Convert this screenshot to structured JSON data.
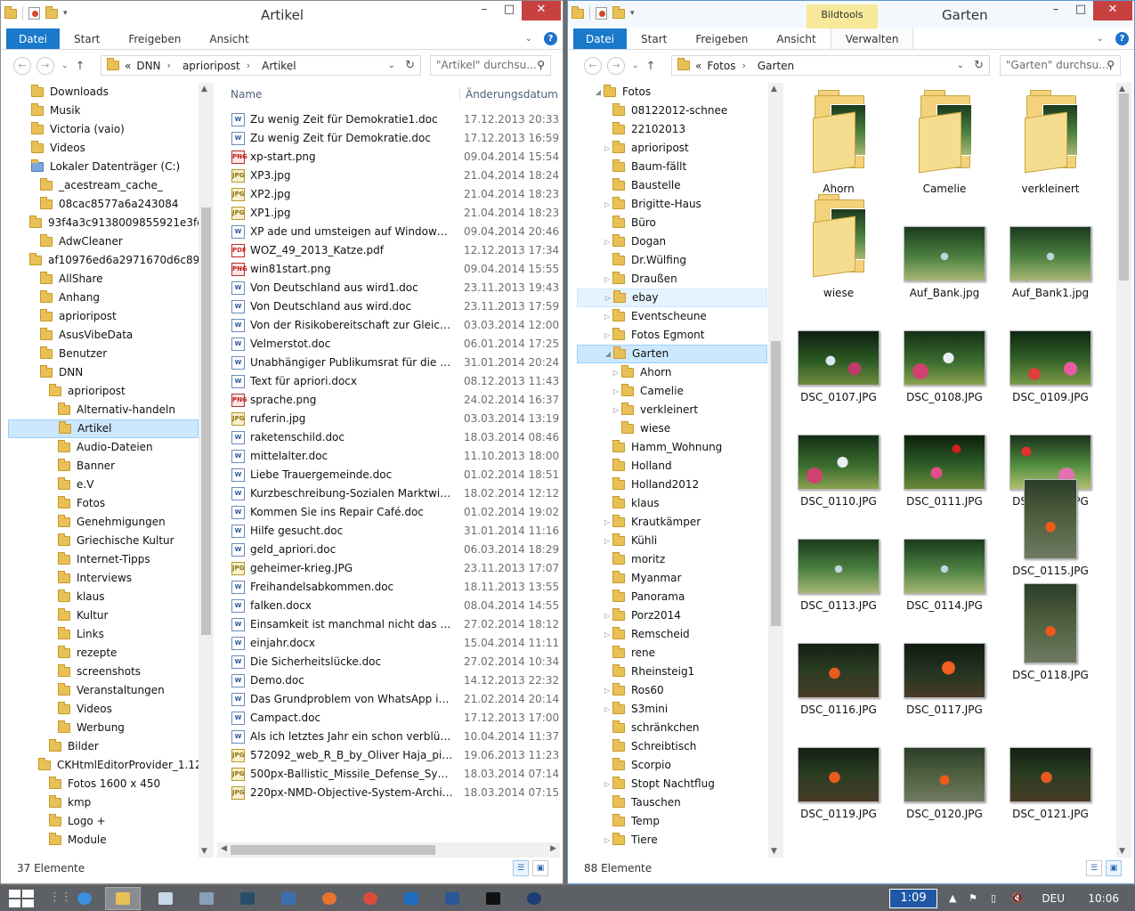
{
  "left": {
    "title": "Artikel",
    "tabs": [
      "Datei",
      "Start",
      "Freigeben",
      "Ansicht"
    ],
    "breadcrumb": [
      "«",
      "DNN",
      "aprioripost",
      "Artikel"
    ],
    "search_placeholder": "\"Artikel\" durchsu...",
    "status": "37 Elemente",
    "col_name": "Name",
    "col_date": "Änderungsdatum",
    "tree": [
      {
        "label": "Downloads",
        "indent": 0,
        "ex": ""
      },
      {
        "label": "Musik",
        "indent": 0,
        "ex": ""
      },
      {
        "label": "Victoria (vaio)",
        "indent": 0,
        "ex": ""
      },
      {
        "label": "Videos",
        "indent": 0,
        "ex": ""
      },
      {
        "label": "Lokaler Datenträger (C:)",
        "indent": 0,
        "ex": "",
        "drive": true
      },
      {
        "label": "_acestream_cache_",
        "indent": 1,
        "ex": ""
      },
      {
        "label": "08cac8577a6a243084",
        "indent": 1,
        "ex": ""
      },
      {
        "label": "93f4a3c9138009855921e3fe",
        "indent": 1,
        "ex": ""
      },
      {
        "label": "AdwCleaner",
        "indent": 1,
        "ex": ""
      },
      {
        "label": "af10976ed6a2971670d6c89be2",
        "indent": 1,
        "ex": ""
      },
      {
        "label": "AllShare",
        "indent": 1,
        "ex": ""
      },
      {
        "label": "Anhang",
        "indent": 1,
        "ex": ""
      },
      {
        "label": "aprioripost",
        "indent": 1,
        "ex": ""
      },
      {
        "label": "AsusVibeData",
        "indent": 1,
        "ex": ""
      },
      {
        "label": "Benutzer",
        "indent": 1,
        "ex": ""
      },
      {
        "label": "DNN",
        "indent": 1,
        "ex": ""
      },
      {
        "label": "aprioripost",
        "indent": 2,
        "ex": ""
      },
      {
        "label": "Alternativ-handeln",
        "indent": 3,
        "ex": ""
      },
      {
        "label": "Artikel",
        "indent": 3,
        "ex": "",
        "sel": true
      },
      {
        "label": "Audio-Dateien",
        "indent": 3,
        "ex": ""
      },
      {
        "label": "Banner",
        "indent": 3,
        "ex": ""
      },
      {
        "label": "e.V",
        "indent": 3,
        "ex": ""
      },
      {
        "label": "Fotos",
        "indent": 3,
        "ex": ""
      },
      {
        "label": "Genehmigungen",
        "indent": 3,
        "ex": ""
      },
      {
        "label": "Griechische Kultur",
        "indent": 3,
        "ex": ""
      },
      {
        "label": "Internet-Tipps",
        "indent": 3,
        "ex": ""
      },
      {
        "label": "Interviews",
        "indent": 3,
        "ex": ""
      },
      {
        "label": "klaus",
        "indent": 3,
        "ex": ""
      },
      {
        "label": "Kultur",
        "indent": 3,
        "ex": ""
      },
      {
        "label": "Links",
        "indent": 3,
        "ex": ""
      },
      {
        "label": "rezepte",
        "indent": 3,
        "ex": ""
      },
      {
        "label": "screenshots",
        "indent": 3,
        "ex": ""
      },
      {
        "label": "Veranstaltungen",
        "indent": 3,
        "ex": ""
      },
      {
        "label": "Videos",
        "indent": 3,
        "ex": ""
      },
      {
        "label": "Werbung",
        "indent": 3,
        "ex": ""
      },
      {
        "label": "Bilder",
        "indent": 2,
        "ex": ""
      },
      {
        "label": "CKHtmlEditorProvider_1.12.",
        "indent": 2,
        "ex": ""
      },
      {
        "label": "Fotos 1600 x 450",
        "indent": 2,
        "ex": ""
      },
      {
        "label": "kmp",
        "indent": 2,
        "ex": ""
      },
      {
        "label": "Logo +",
        "indent": 2,
        "ex": ""
      },
      {
        "label": "Module",
        "indent": 2,
        "ex": ""
      }
    ],
    "files": [
      {
        "name": "Zu wenig Zeit für Demokratie1.doc",
        "date": "17.12.2013 20:33",
        "type": "doc"
      },
      {
        "name": "Zu wenig Zeit für Demokratie.doc",
        "date": "17.12.2013 16:59",
        "type": "doc"
      },
      {
        "name": "xp-start.png",
        "date": "09.04.2014 15:54",
        "type": "png"
      },
      {
        "name": "XP3.jpg",
        "date": "21.04.2014 18:24",
        "type": "jpg"
      },
      {
        "name": "XP2.jpg",
        "date": "21.04.2014 18:23",
        "type": "jpg"
      },
      {
        "name": "XP1.jpg",
        "date": "21.04.2014 18:23",
        "type": "jpg"
      },
      {
        "name": "XP ade und umsteigen auf Windows 8.do...",
        "date": "09.04.2014 20:46",
        "type": "doc"
      },
      {
        "name": "WOZ_49_2013_Katze.pdf",
        "date": "12.12.2013 17:34",
        "type": "pdf"
      },
      {
        "name": "win81start.png",
        "date": "09.04.2014 15:55",
        "type": "png"
      },
      {
        "name": "Von Deutschland aus wird1.doc",
        "date": "23.11.2013 19:43",
        "type": "doc"
      },
      {
        "name": "Von Deutschland aus wird.doc",
        "date": "23.11.2013 17:59",
        "type": "doc"
      },
      {
        "name": "Von der Risikobereitschaft zur Gleichgülti...",
        "date": "03.03.2014 12:00",
        "type": "doc"
      },
      {
        "name": "Velmerstot.doc",
        "date": "06.01.2014 17:25",
        "type": "doc"
      },
      {
        "name": "Unabhängiger Publikumsrat für die öffen...",
        "date": "31.01.2014 20:24",
        "type": "doc"
      },
      {
        "name": "Text für apriori.docx",
        "date": "08.12.2013 11:43",
        "type": "doc"
      },
      {
        "name": "sprache.png",
        "date": "24.02.2014 16:37",
        "type": "png"
      },
      {
        "name": "ruferin.jpg",
        "date": "03.03.2014 13:19",
        "type": "jpg"
      },
      {
        "name": "raketenschild.doc",
        "date": "18.03.2014 08:46",
        "type": "doc"
      },
      {
        "name": "mittelalter.doc",
        "date": "11.10.2013 18:00",
        "type": "doc"
      },
      {
        "name": "Liebe Trauergemeinde.doc",
        "date": "01.02.2014 18:51",
        "type": "doc"
      },
      {
        "name": "Kurzbeschreibung-Sozialen Marktwirtsch...",
        "date": "18.02.2014 12:12",
        "type": "doc"
      },
      {
        "name": "Kommen Sie ins Repair Café.doc",
        "date": "01.02.2014 19:02",
        "type": "doc"
      },
      {
        "name": "Hilfe gesucht.doc",
        "date": "31.01.2014 11:16",
        "type": "doc"
      },
      {
        "name": "geld_apriori.doc",
        "date": "06.03.2014 18:29",
        "type": "doc"
      },
      {
        "name": "geheimer-krieg.JPG",
        "date": "23.11.2013 17:07",
        "type": "jpg"
      },
      {
        "name": "Freihandelsabkommen.doc",
        "date": "18.11.2013 13:55",
        "type": "doc"
      },
      {
        "name": "falken.docx",
        "date": "08.04.2014 14:55",
        "type": "doc"
      },
      {
        "name": "Einsamkeit ist manchmal nicht das schle...",
        "date": "27.02.2014 18:12",
        "type": "doc"
      },
      {
        "name": "einjahr.docx",
        "date": "15.04.2014 11:11",
        "type": "doc"
      },
      {
        "name": "Die Sicherheitslücke.doc",
        "date": "27.02.2014 10:34",
        "type": "doc"
      },
      {
        "name": "Demo.doc",
        "date": "14.12.2013 22:32",
        "type": "doc"
      },
      {
        "name": "Das Grundproblem von WhatsApp ist.doc",
        "date": "21.02.2014 20:14",
        "type": "doc"
      },
      {
        "name": "Campact.doc",
        "date": "17.12.2013 17:00",
        "type": "doc"
      },
      {
        "name": "Als ich letztes Jahr ein schon verblühte K...",
        "date": "10.04.2014 11:37",
        "type": "doc"
      },
      {
        "name": "572092_web_R_B_by_Oliver Haja_pixelio.d...",
        "date": "19.06.2013 11:23",
        "type": "jpg"
      },
      {
        "name": "500px-Ballistic_Missile_Defense_System_(...",
        "date": "18.03.2014 07:14",
        "type": "jpg"
      },
      {
        "name": "220px-NMD-Objective-System-Architect...",
        "date": "18.03.2014 07:15",
        "type": "jpg"
      }
    ]
  },
  "right": {
    "title": "Garten",
    "context_tab": "Bildtools",
    "tabs": [
      "Datei",
      "Start",
      "Freigeben",
      "Ansicht",
      "Verwalten"
    ],
    "breadcrumb": [
      "«",
      "Fotos",
      "Garten"
    ],
    "search_placeholder": "\"Garten\" durchsu...",
    "status": "88 Elemente",
    "tree": [
      {
        "label": "Fotos",
        "indent": 0,
        "ex": "◢"
      },
      {
        "label": "08122012-schnee",
        "indent": 1,
        "ex": ""
      },
      {
        "label": "22102013",
        "indent": 1,
        "ex": ""
      },
      {
        "label": "aprioripost",
        "indent": 1,
        "ex": "▷"
      },
      {
        "label": "Baum-fällt",
        "indent": 1,
        "ex": ""
      },
      {
        "label": "Baustelle",
        "indent": 1,
        "ex": ""
      },
      {
        "label": "Brigitte-Haus",
        "indent": 1,
        "ex": "▷"
      },
      {
        "label": "Büro",
        "indent": 1,
        "ex": ""
      },
      {
        "label": "Dogan",
        "indent": 1,
        "ex": "▷"
      },
      {
        "label": "Dr.Wülfing",
        "indent": 1,
        "ex": ""
      },
      {
        "label": "Draußen",
        "indent": 1,
        "ex": "▷"
      },
      {
        "label": "ebay",
        "indent": 1,
        "ex": "▷",
        "hov": true
      },
      {
        "label": "Eventscheune",
        "indent": 1,
        "ex": "▷"
      },
      {
        "label": "Fotos Egmont",
        "indent": 1,
        "ex": "▷"
      },
      {
        "label": "Garten",
        "indent": 1,
        "ex": "◢",
        "sel": true
      },
      {
        "label": "Ahorn",
        "indent": 2,
        "ex": "▷"
      },
      {
        "label": "Camelie",
        "indent": 2,
        "ex": "▷"
      },
      {
        "label": "verkleinert",
        "indent": 2,
        "ex": "▷"
      },
      {
        "label": "wiese",
        "indent": 2,
        "ex": ""
      },
      {
        "label": "Hamm_Wohnung",
        "indent": 1,
        "ex": ""
      },
      {
        "label": "Holland",
        "indent": 1,
        "ex": ""
      },
      {
        "label": "Holland2012",
        "indent": 1,
        "ex": ""
      },
      {
        "label": "klaus",
        "indent": 1,
        "ex": ""
      },
      {
        "label": "Krautkämper",
        "indent": 1,
        "ex": "▷"
      },
      {
        "label": "Kühli",
        "indent": 1,
        "ex": "▷"
      },
      {
        "label": "moritz",
        "indent": 1,
        "ex": ""
      },
      {
        "label": "Myanmar",
        "indent": 1,
        "ex": ""
      },
      {
        "label": "Panorama",
        "indent": 1,
        "ex": ""
      },
      {
        "label": "Porz2014",
        "indent": 1,
        "ex": "▷"
      },
      {
        "label": "Remscheid",
        "indent": 1,
        "ex": "▷"
      },
      {
        "label": "rene",
        "indent": 1,
        "ex": ""
      },
      {
        "label": "Rheinsteig1",
        "indent": 1,
        "ex": ""
      },
      {
        "label": "Ros60",
        "indent": 1,
        "ex": "▷"
      },
      {
        "label": "S3mini",
        "indent": 1,
        "ex": "▷"
      },
      {
        "label": "schränkchen",
        "indent": 1,
        "ex": ""
      },
      {
        "label": "Schreibtisch",
        "indent": 1,
        "ex": ""
      },
      {
        "label": "Scorpio",
        "indent": 1,
        "ex": ""
      },
      {
        "label": "Stopt Nachtflug",
        "indent": 1,
        "ex": "▷"
      },
      {
        "label": "Tauschen",
        "indent": 1,
        "ex": ""
      },
      {
        "label": "Temp",
        "indent": 1,
        "ex": ""
      },
      {
        "label": "Tiere",
        "indent": 1,
        "ex": "▷"
      }
    ],
    "items": [
      {
        "label": "Ahorn",
        "kind": "folder"
      },
      {
        "label": "Camelie",
        "kind": "folder"
      },
      {
        "label": "verkleinert",
        "kind": "folder"
      },
      {
        "label": "wiese",
        "kind": "folder"
      },
      {
        "label": "Auf_Bank.jpg",
        "kind": "g4"
      },
      {
        "label": "Auf_Bank1.jpg",
        "kind": "g4"
      },
      {
        "label": "DSC_0107.JPG",
        "kind": "g1"
      },
      {
        "label": "DSC_0108.JPG",
        "kind": "g2"
      },
      {
        "label": "DSC_0109.JPG",
        "kind": "g3"
      },
      {
        "label": "DSC_0110.JPG",
        "kind": "g2"
      },
      {
        "label": "DSC_0111.JPG",
        "kind": "g5"
      },
      {
        "label": "DSC_0112.JPG",
        "kind": "g6"
      },
      {
        "label": "DSC_0113.JPG",
        "kind": "g4"
      },
      {
        "label": "DSC_0114.JPG",
        "kind": "g4"
      },
      {
        "label": "DSC_0115.JPG",
        "kind": "o3",
        "tall": true
      },
      {
        "label": "DSC_0116.JPG",
        "kind": "o1"
      },
      {
        "label": "DSC_0117.JPG",
        "kind": "o2"
      },
      {
        "label": "DSC_0118.JPG",
        "kind": "o3",
        "tall": true
      },
      {
        "label": "DSC_0119.JPG",
        "kind": "o1"
      },
      {
        "label": "DSC_0120.JPG",
        "kind": "o3"
      },
      {
        "label": "DSC_0121.JPG",
        "kind": "o1"
      }
    ]
  },
  "taskbar": {
    "timer": "1:09",
    "lang": "DEU",
    "clock": "10:06"
  }
}
